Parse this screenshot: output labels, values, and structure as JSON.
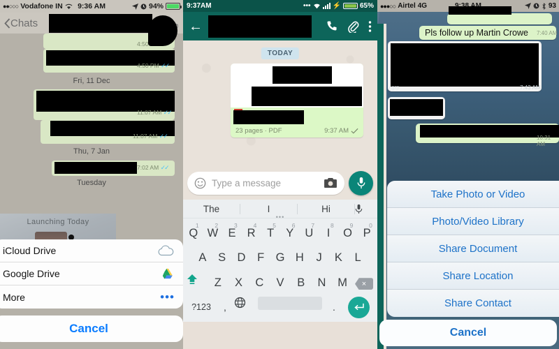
{
  "panel1": {
    "status": {
      "carrier": "Vodafone IN",
      "time": "9:36 AM",
      "battery": "94%"
    },
    "navbar": {
      "back_label": "Chats"
    },
    "date_separators": [
      "Fri, 11 Dec",
      "Thu, 7 Jan",
      "Tuesday"
    ],
    "timestamps": [
      "4:50 PM",
      "4:50 PM",
      "11:07 AM",
      "11:07 AM",
      "7:02 AM"
    ],
    "image_preview": {
      "caption": "Launching Today"
    },
    "sheet": {
      "items": [
        {
          "label": "iCloud Drive",
          "icon": "icloud-drive-icon"
        },
        {
          "label": "Google Drive",
          "icon": "google-drive-icon"
        },
        {
          "label": "More",
          "icon": "ellipsis-icon"
        }
      ],
      "cancel_label": "Cancel"
    }
  },
  "panel2": {
    "status": {
      "time": "9:37AM",
      "battery": "65%"
    },
    "appbar": {
      "back_icon": "back-arrow-icon",
      "call_icon": "phone-icon",
      "attach_icon": "paperclip-icon",
      "menu_icon": "overflow-menu-icon"
    },
    "date_separator": "TODAY",
    "document_message": {
      "meta": "23 pages  ·  PDF",
      "time": "9:37 AM",
      "status_icon": "single-check-icon"
    },
    "input": {
      "placeholder": "Type a message",
      "emoji_icon": "emoji-icon",
      "camera_icon": "camera-icon",
      "mic_icon": "mic-icon"
    },
    "suggestions": [
      "The",
      "I",
      "Hi"
    ],
    "keyboard": {
      "row1": [
        {
          "key": "Q",
          "num": "1"
        },
        {
          "key": "W",
          "num": "2"
        },
        {
          "key": "E",
          "num": "3"
        },
        {
          "key": "R",
          "num": "4"
        },
        {
          "key": "T",
          "num": "5"
        },
        {
          "key": "Y",
          "num": "6"
        },
        {
          "key": "U",
          "num": "7"
        },
        {
          "key": "I",
          "num": "8"
        },
        {
          "key": "O",
          "num": "9"
        },
        {
          "key": "P",
          "num": "0"
        }
      ],
      "row2": [
        "A",
        "S",
        "D",
        "F",
        "G",
        "H",
        "J",
        "K",
        "L"
      ],
      "row3": [
        "Z",
        "X",
        "C",
        "V",
        "B",
        "N",
        "M"
      ],
      "shift_icon": "shift-icon",
      "backspace_icon": "backspace-icon",
      "numeric_label": "?123",
      "comma": ",",
      "period": ".",
      "globe_icon": "globe-icon",
      "enter_icon": "enter-icon"
    }
  },
  "panel3": {
    "status": {
      "carrier": "Airtel",
      "network": "4G",
      "time": "9:38 AM",
      "battery": "93"
    },
    "messages": [
      {
        "text": "Pls follow up Martin Crowe",
        "time": "7:40 AM",
        "side": "right"
      },
      {
        "text": "grp",
        "time": "7:43 AM",
        "side": "right"
      },
      {
        "text": "",
        "time": "10:31 AM",
        "side": "right"
      }
    ],
    "sheet": {
      "items": [
        "Take Photo or Video",
        "Photo/Video Library",
        "Share Document",
        "Share Location",
        "Share Contact"
      ],
      "cancel_label": "Cancel"
    }
  }
}
